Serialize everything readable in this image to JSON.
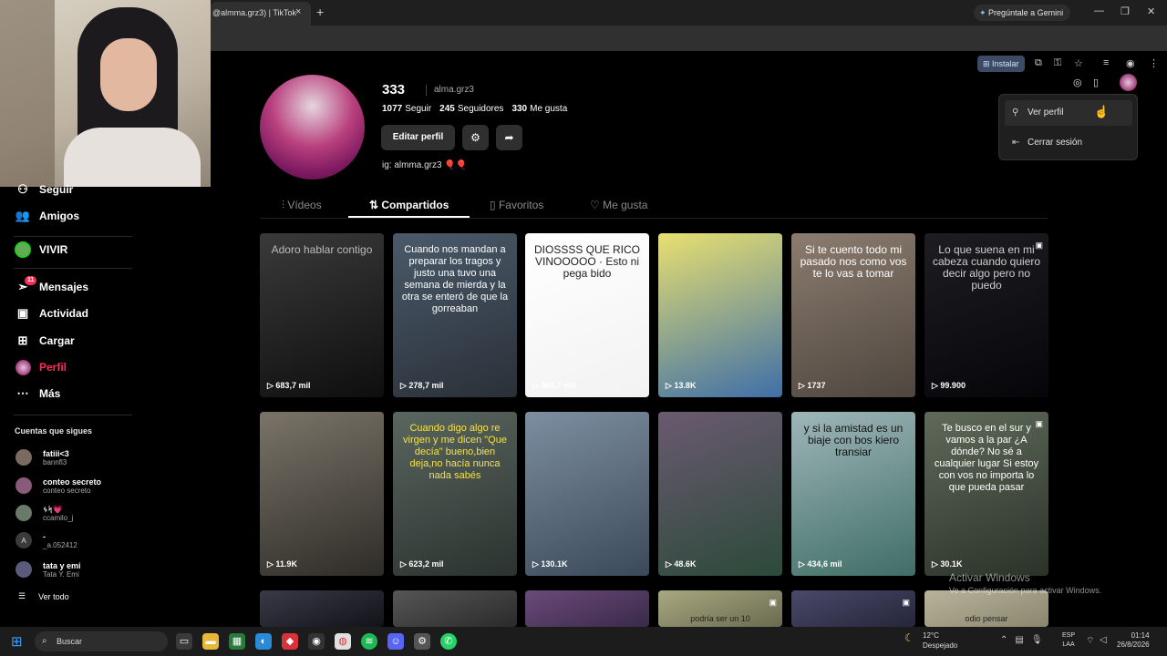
{
  "browser": {
    "tab_title": "@almma.grz3) | TikTok",
    "tab_close": "×",
    "new_tab": "+",
    "gemini_label": "Pregúntale a Gemini",
    "install_label": "Instalar"
  },
  "sidebar": {
    "partial_item": "Seguir",
    "items": [
      {
        "label": "Amigos",
        "icon": "friends-icon"
      },
      {
        "label": "VIVIR",
        "icon": "live-icon"
      },
      {
        "label": "Mensajes",
        "icon": "messages-icon",
        "badge": "11"
      },
      {
        "label": "Actividad",
        "icon": "activity-icon"
      },
      {
        "label": "Cargar",
        "icon": "upload-icon"
      },
      {
        "label": "Perfil",
        "icon": "profile-icon"
      },
      {
        "label": "Más",
        "icon": "more-icon"
      }
    ],
    "following_title": "Cuentas que sigues",
    "following": [
      {
        "name": "fatiii<3",
        "handle": "bannfl3"
      },
      {
        "name": "conteo secreto",
        "handle": "conteo secreto"
      },
      {
        "name": "ᛃᛋ💗",
        "handle": "ccamilo_j"
      },
      {
        "name": "-",
        "handle": "_a.052412",
        "initial": "A"
      },
      {
        "name": "tata y emi",
        "handle": "Tata Y. Emi"
      }
    ],
    "see_all": "Ver todo"
  },
  "profile": {
    "username": "333",
    "handle": "alma.grz3",
    "following_count": "1077",
    "following_label": "Seguir",
    "followers_count": "245",
    "followers_label": "Seguidores",
    "likes_count": "330",
    "likes_label": "Me gusta",
    "edit_button": "Editar perfil",
    "bio": "ig: almma.grz3 🎈🎈"
  },
  "tabs": [
    {
      "label": "Vídeos"
    },
    {
      "label": "Compartidos",
      "active": true
    },
    {
      "label": "Favoritos"
    },
    {
      "label": "Me gusta"
    }
  ],
  "menu": {
    "view_profile": "Ver perfil",
    "logout": "Cerrar sesión"
  },
  "videos": [
    {
      "views": "683,7 mil",
      "text": "Adoro hablar contigo",
      "colors": [
        "#3a3a3a",
        "#0e0e0e"
      ],
      "text_color": "#bbbbbb"
    },
    {
      "views": "278,7 mil",
      "text": "Cuando nos mandan a preparar los tragos y justo una tuvo una semana de mierda y la otra se enteró de que la gorreaban",
      "colors": [
        "#4a5a6a",
        "#2a3038"
      ],
      "text_color": "#ffffff"
    },
    {
      "views": "566,7 mil",
      "text": "DIOSSSS QUE RICO VINOOOOO · Esto ni pega bido",
      "colors": [
        "#ffffff",
        "#f2f2f2"
      ],
      "text_color": "#222222"
    },
    {
      "views": "13.8K",
      "text": "",
      "colors": [
        "#e8e070",
        "#3e6fa8"
      ],
      "text_color": "#ffffff"
    },
    {
      "views": "1737",
      "text": "Si te cuento todo mi pasado nos como vos te lo vas a tomar",
      "colors": [
        "#8b7c6e",
        "#4e463f"
      ],
      "text_color": "#ffffff"
    },
    {
      "views": "99.900",
      "text": "Lo que suena en mi cabeza cuando quiero decir algo pero no puedo",
      "colors": [
        "#1e1e22",
        "#05050a"
      ],
      "text_color": "#cfcfcf",
      "pinned": true
    },
    {
      "views": "11.9K",
      "text": "",
      "colors": [
        "#7a7468",
        "#2e2c28"
      ],
      "text_color": "#ffffff"
    },
    {
      "views": "623,2 mil",
      "text": "Cuando digo algo re virgen y me dicen \"Que decía\" bueno,bien deja,no hacía nunca nada sabés",
      "colors": [
        "#5a6660",
        "#2b322f"
      ],
      "text_color": "#f5e24a"
    },
    {
      "views": "130.1K",
      "text": "",
      "colors": [
        "#7d8ea0",
        "#3b4a5a"
      ],
      "text_color": "#ffffff"
    },
    {
      "views": "48.6K",
      "text": "",
      "colors": [
        "#6a5a70",
        "#2c4a3a"
      ],
      "text_color": "#ffffff"
    },
    {
      "views": "434,6 mil",
      "text": "y si la amistad es un biaje con bos kiero transiar",
      "colors": [
        "#9fb6b8",
        "#3f6e66"
      ],
      "text_color": "#111111"
    },
    {
      "views": "30.1K",
      "text": "Te busco en el sur y vamos a la par ¿A dónde? No sé a cualquier lugar Si estoy con vos no importa lo que pueda pasar",
      "colors": [
        "#5f6a5a",
        "#2b3228"
      ],
      "text_color": "#ffffff",
      "pinned": true
    },
    {
      "views": "",
      "text": "",
      "colors": [
        "#3a3a48",
        "#121218"
      ],
      "text_color": "#ffffff"
    },
    {
      "views": "",
      "text": "",
      "colors": [
        "#565656",
        "#2a2a2a"
      ],
      "text_color": "#ffffff"
    },
    {
      "views": "",
      "text": "",
      "colors": [
        "#6b4a7a",
        "#3a2a48"
      ],
      "text_color": "#ffffff"
    },
    {
      "views": "",
      "text": "podría ser un 10",
      "colors": [
        "#a8a880",
        "#6a6a50"
      ],
      "text_color": "#222222",
      "pinned": true
    },
    {
      "views": "",
      "text": "",
      "colors": [
        "#4a4a6a",
        "#25253a"
      ],
      "text_color": "#ffffff",
      "pinned": true
    },
    {
      "views": "",
      "text": "odio pensar",
      "colors": [
        "#b8b39a",
        "#8a866f"
      ],
      "text_color": "#222222"
    }
  ],
  "watermark": {
    "title": "Activar Windows",
    "subtitle": "Ve a Configuración para activar Windows."
  },
  "taskbar": {
    "search_label": "Buscar",
    "weather_temp": "12°C",
    "weather_desc": "Despejado",
    "lang_top": "ESP",
    "lang_bottom": "LAA",
    "time": "01:14",
    "date": "26/8/2026"
  }
}
